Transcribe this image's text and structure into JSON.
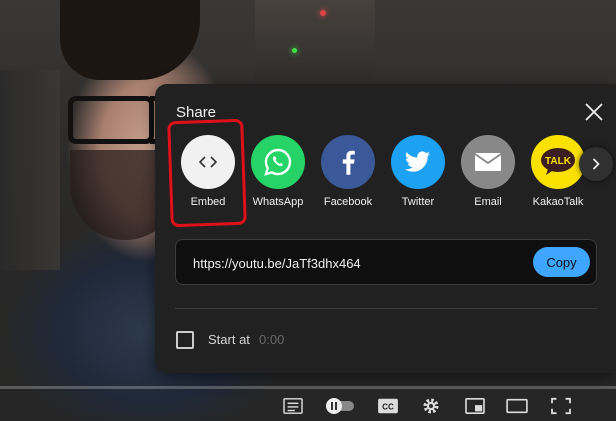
{
  "share": {
    "title": "Share",
    "targets": [
      {
        "label": "Embed",
        "icon": "embed-icon",
        "color": "#f1f1f1"
      },
      {
        "label": "WhatsApp",
        "icon": "whatsapp-icon",
        "color": "#25d366"
      },
      {
        "label": "Facebook",
        "icon": "facebook-icon",
        "color": "#3b5998"
      },
      {
        "label": "Twitter",
        "icon": "twitter-icon",
        "color": "#1da1f2"
      },
      {
        "label": "Email",
        "icon": "email-icon",
        "color": "#888888"
      },
      {
        "label": "KakaoTalk",
        "icon": "kakaotalk-icon",
        "color": "#fae100"
      }
    ],
    "kakao_badge": "TALK",
    "url": "https://youtu.be/JaTf3dhx464",
    "copy_label": "Copy",
    "start_at_label": "Start at",
    "start_at_value": "0:00",
    "accent": "#3ea6ff",
    "highlight_color": "#e0101a"
  },
  "player": {
    "controls": [
      "transcript-icon",
      "autoplay-toggle",
      "subtitles-icon",
      "settings-icon",
      "miniplayer-icon",
      "theater-icon",
      "fullscreen-icon"
    ],
    "cc_label": "CC"
  }
}
